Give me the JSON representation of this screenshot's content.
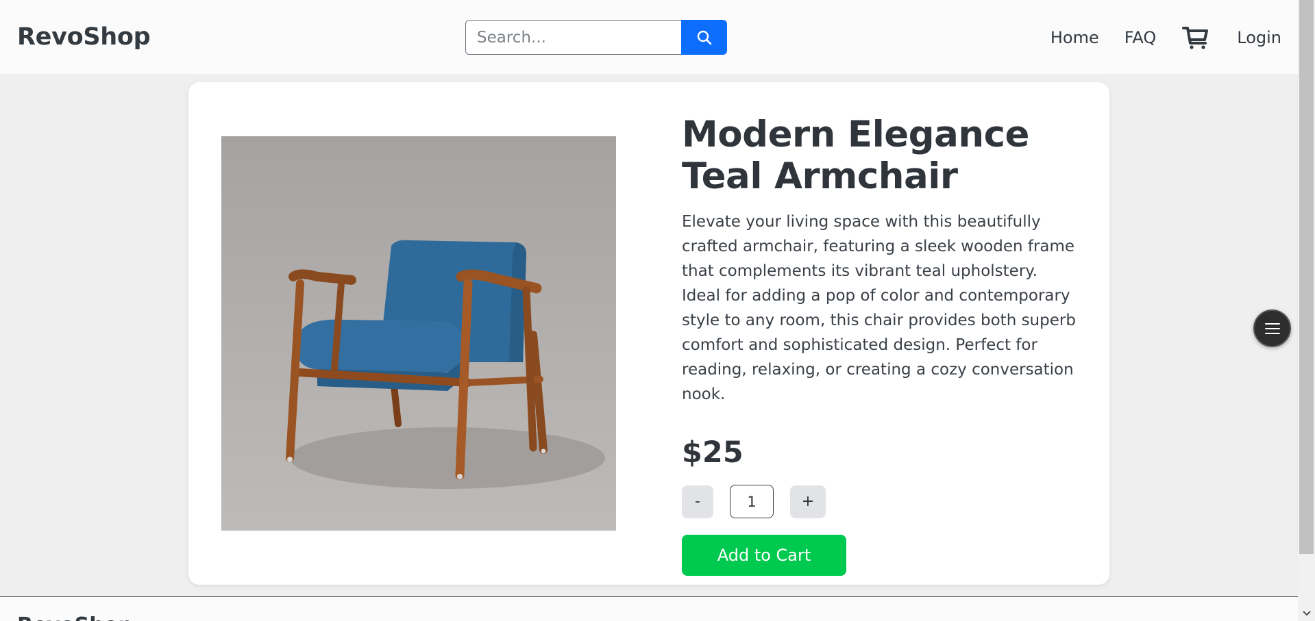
{
  "header": {
    "brand": "RevoShop",
    "search_placeholder": "Search...",
    "nav": {
      "home": "Home",
      "faq": "FAQ",
      "login": "Login"
    }
  },
  "product": {
    "title": "Modern Elegance Teal Armchair",
    "description": "Elevate your living space with this beautifully crafted armchair, featuring a sleek wooden frame that complements its vibrant teal upholstery. Ideal for adding a pop of color and contemporary style to any room, this chair provides both superb comfort and sophisticated design. Perfect for reading, relaxing, or creating a cozy conversation nook.",
    "price": "$25",
    "quantity": "1",
    "decrement_label": "-",
    "increment_label": "+",
    "add_to_cart_label": "Add to Cart"
  },
  "footer": {
    "brand": "RevoShop"
  },
  "icons": {
    "search": "search-icon",
    "cart": "cart-icon",
    "menu": "menu-icon"
  },
  "colors": {
    "primary": "#0d6efd",
    "success": "#00c94f",
    "text_dark": "#333a40",
    "background": "#efefef"
  }
}
